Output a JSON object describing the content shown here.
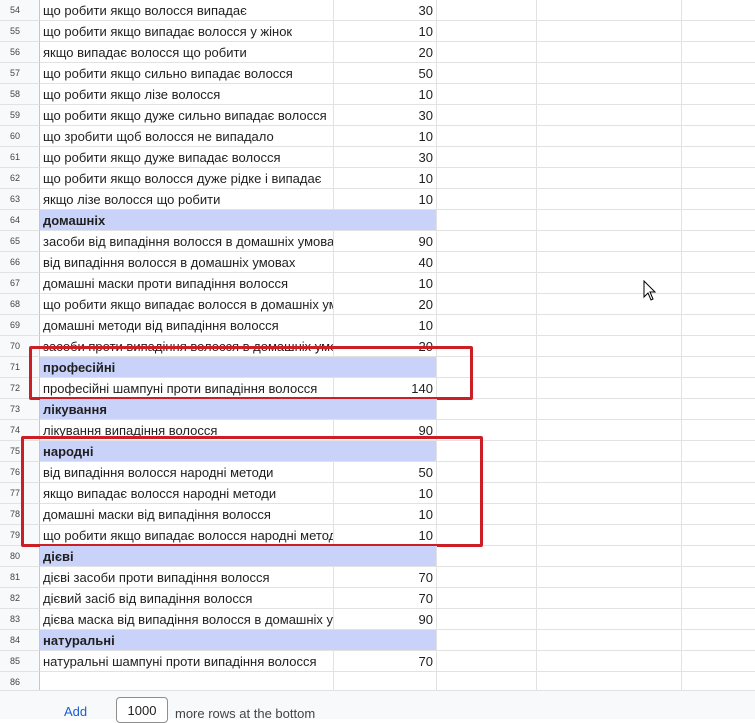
{
  "rows": [
    {
      "n": "54",
      "text": "що робити якщо волосся випадає",
      "value": "30"
    },
    {
      "n": "55",
      "text": "що робити якщо випадає волосся у жінок",
      "value": "10"
    },
    {
      "n": "56",
      "text": "якщо випадає волосся що робити",
      "value": "20"
    },
    {
      "n": "57",
      "text": "що робити якщо сильно випадає волосся",
      "value": "50"
    },
    {
      "n": "58",
      "text": "що робити якщо лізе волосся",
      "value": "10"
    },
    {
      "n": "59",
      "text": "що робити якщо дуже сильно випадає волосся",
      "value": "30"
    },
    {
      "n": "60",
      "text": "що зробити щоб волосся не випадало",
      "value": "10"
    },
    {
      "n": "61",
      "text": "що робити якщо дуже випадає волосся",
      "value": "30"
    },
    {
      "n": "62",
      "text": "що робити якщо волосся дуже рідке і випадає",
      "value": "10"
    },
    {
      "n": "63",
      "text": "якщо лізе волосся що робити",
      "value": "10"
    },
    {
      "n": "64",
      "text": "домашніх",
      "value": "",
      "category": true
    },
    {
      "n": "65",
      "text": "засоби від випадіння волосся в домашніх умовах",
      "value": "90"
    },
    {
      "n": "66",
      "text": "від випадіння волосся в домашніх умовах",
      "value": "40"
    },
    {
      "n": "67",
      "text": "домашні маски проти випадіння волосся",
      "value": "10"
    },
    {
      "n": "68",
      "text": "що робити якщо випадає волосся в домашніх умовах",
      "value": "20"
    },
    {
      "n": "69",
      "text": "домашні методи від випадіння волосся",
      "value": "10"
    },
    {
      "n": "70",
      "text": "засоби проти випадіння волосся в домашніх умовах",
      "value": "20"
    },
    {
      "n": "71",
      "text": "професійні",
      "value": "",
      "category": true
    },
    {
      "n": "72",
      "text": "професійні шампуні проти випадіння волосся",
      "value": "140"
    },
    {
      "n": "73",
      "text": "лікування",
      "value": "",
      "category": true
    },
    {
      "n": "74",
      "text": "лікування випадіння волосся",
      "value": "90"
    },
    {
      "n": "75",
      "text": "народні",
      "value": "",
      "category": true
    },
    {
      "n": "76",
      "text": "від випадіння волосся народні методи",
      "value": "50"
    },
    {
      "n": "77",
      "text": "якщо випадає волосся народні методи",
      "value": "10"
    },
    {
      "n": "78",
      "text": "домашні маски від випадіння волосся",
      "value": "10"
    },
    {
      "n": "79",
      "text": "що робити якщо випадає волосся народні методи",
      "value": "10"
    },
    {
      "n": "80",
      "text": "дієві",
      "value": "",
      "category": true
    },
    {
      "n": "81",
      "text": "дієві засоби проти випадіння волосся",
      "value": "70"
    },
    {
      "n": "82",
      "text": "дієвий засіб від випадіння волосся",
      "value": "70"
    },
    {
      "n": "83",
      "text": "дієва маска від випадіння волосся в домашніх умовах",
      "value": "90"
    },
    {
      "n": "84",
      "text": "натуральні",
      "value": "",
      "category": true
    },
    {
      "n": "85",
      "text": "натуральні шампуні проти випадіння волосся",
      "value": "70"
    },
    {
      "n": "86",
      "text": "",
      "value": ""
    }
  ],
  "footer": {
    "add_label": "Add",
    "rows_value": "1000",
    "more_label": "more rows at the bottom"
  },
  "colors": {
    "category_fill": "#c9d3f9",
    "highlight_border": "#cc1f25",
    "link": "#1a5ed6"
  },
  "icons": {
    "mouse_cursor": "arrow-cursor-icon"
  }
}
